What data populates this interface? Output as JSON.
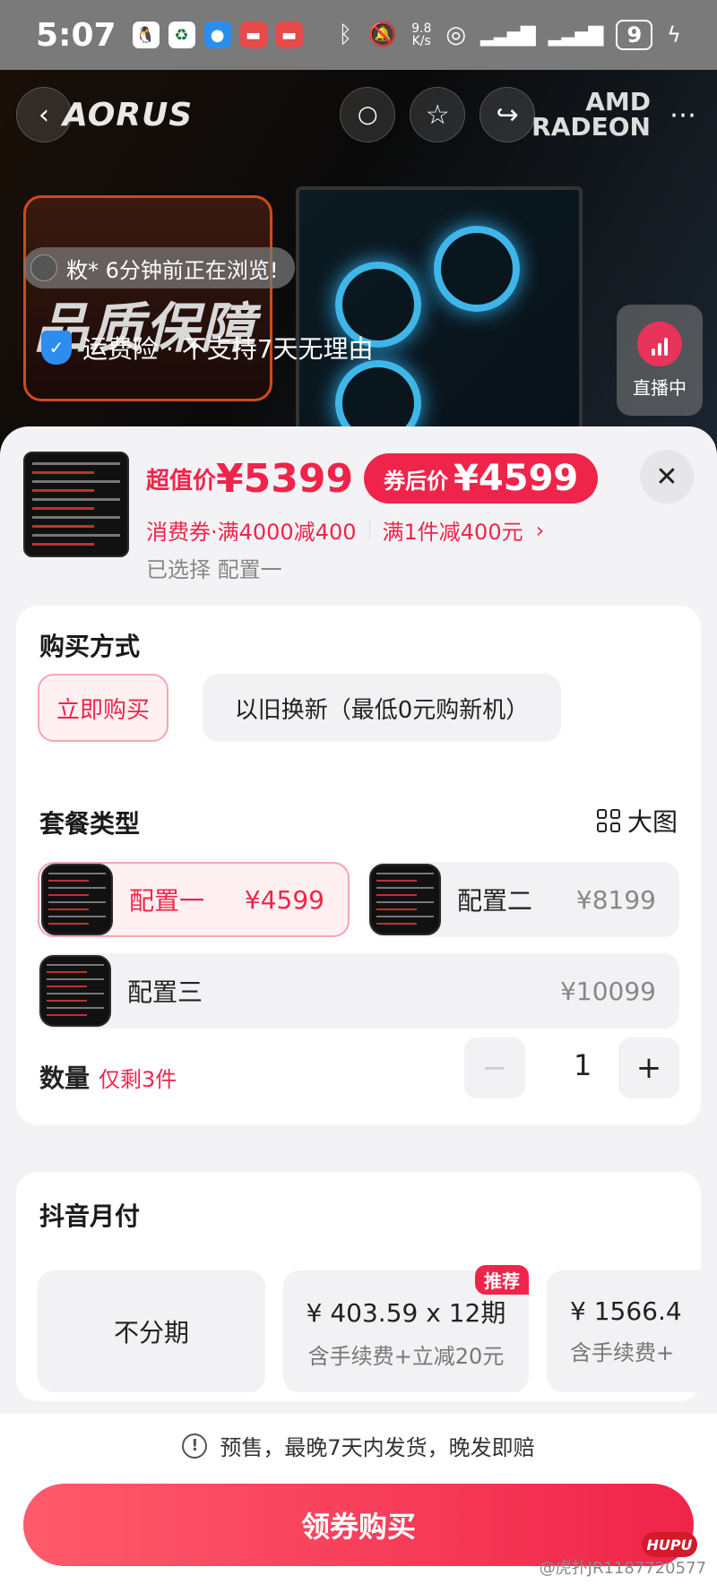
{
  "status_bar": {
    "time": "5:07",
    "net_speed_top": "9.8",
    "net_speed_bottom": "K/s",
    "battery": "9"
  },
  "hero": {
    "brand": "AORUS",
    "amd_line1": "AMD",
    "amd_line2": "RADEON",
    "promo_text": "品质保障",
    "browse_notice": "敉* 6分钟前正在浏览!",
    "shipping_text": "运费险 · 不支持7天无理由",
    "live_label": "直播中"
  },
  "summary": {
    "price_label": "超值价",
    "price": "¥5399",
    "coupon_label": "券后价",
    "coupon_price": "¥4599",
    "promo_coupon": "消费券·满4000减400",
    "promo_discount": "满1件减400元",
    "selected": "已选择 配置一"
  },
  "purchase": {
    "title": "购买方式",
    "options": [
      "立即购买",
      "以旧换新（最低0元购新机）"
    ]
  },
  "package": {
    "title": "套餐类型",
    "big_pic": "大图",
    "items": [
      {
        "name": "配置一",
        "price": "¥4599"
      },
      {
        "name": "配置二",
        "price": "¥8199"
      },
      {
        "name": "配置三",
        "price": "¥10099"
      }
    ]
  },
  "quantity": {
    "label": "数量",
    "stock_warning": "仅剩3件",
    "value": "1",
    "minus": "−",
    "plus": "+"
  },
  "payment": {
    "title": "抖音月付",
    "options": [
      {
        "main": "不分期",
        "sub": ""
      },
      {
        "main": "¥ 403.59 x 12期",
        "sub": "含手续费+立减20元",
        "tag": "推荐"
      },
      {
        "main": "¥ 1566.4",
        "sub": "含手续费+"
      }
    ]
  },
  "footer": {
    "notice": "预售，最晚7天内发货，晚发即赔",
    "buy_button": "领券购买",
    "watermark": "@虎扑JR1187720577",
    "hupu": "HUPU"
  },
  "colors": {
    "accent": "#f0244a",
    "active_bg": "#fff0f1",
    "chip_bg": "#f2f2f4"
  }
}
